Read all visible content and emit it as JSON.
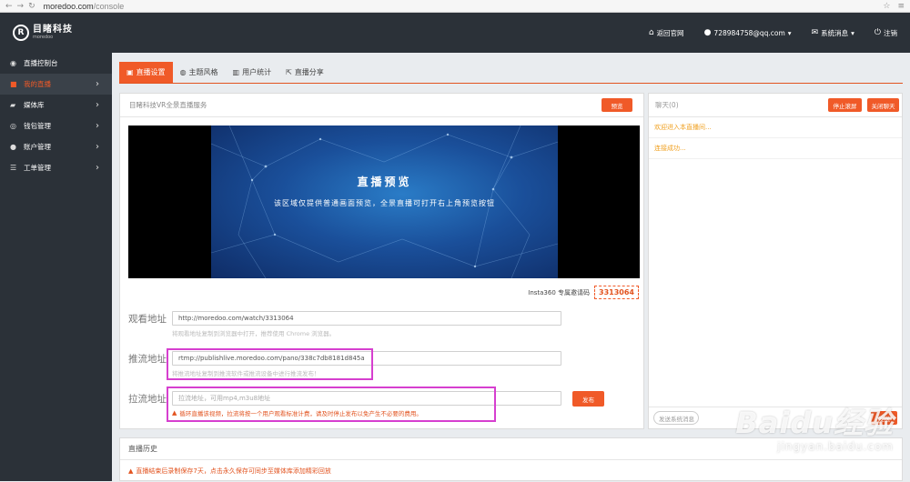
{
  "browser": {
    "url_host": "moredoo.com",
    "url_path": "/console"
  },
  "header": {
    "logo_cn": "目睹科技",
    "logo_en": "moredoo",
    "back_home": "返回官网",
    "user_email": "728984758@qq.com",
    "sys_msg": "系统消息",
    "logout": "注销"
  },
  "sidebar": {
    "items": [
      {
        "label": "直播控制台",
        "icon": "dashboard-icon"
      },
      {
        "label": "我的直播",
        "icon": "video-camera-icon"
      },
      {
        "label": "媒体库",
        "icon": "media-library-icon"
      },
      {
        "label": "钱包管理",
        "icon": "wallet-icon"
      },
      {
        "label": "账户管理",
        "icon": "user-icon"
      },
      {
        "label": "工单管理",
        "icon": "list-icon"
      }
    ]
  },
  "tabs": [
    {
      "label": "直播设置",
      "icon": "settings-icon"
    },
    {
      "label": "主题风格",
      "icon": "palette-icon"
    },
    {
      "label": "用户统计",
      "icon": "chart-icon"
    },
    {
      "label": "直播分享",
      "icon": "share-icon"
    }
  ],
  "main": {
    "panel_title": "目睹科技VR全景直播服务",
    "preview_button": "预览",
    "video_title": "直播预览",
    "video_subtitle": "该区域仅提供普通画面预览，全景直播可打开右上角预览按钮",
    "invite_label": "Insta360 专属邀请码",
    "invite_code": "3313064",
    "watch_label": "观看地址",
    "watch_url": "http://moredoo.com/watch/3313064",
    "watch_hint": "将观看地址复制到浏览器中打开，推荐使用 Chrome 浏览器。",
    "push_label": "推流地址",
    "push_url": "rtmp://publishlive.moredoo.com/pano/338c7db8181d845a",
    "push_hint": "将推流地址复制到推流软件或推流设备中进行推流发布！",
    "pull_label": "拉流地址",
    "pull_placeholder": "拉流地址，可用mp4,m3u8地址",
    "pull_warning": "循环直播该视频，拉流将按一个用户观看标准计费，请及时停止发布以免产生不必要的费用。",
    "publish_button": "发布"
  },
  "chat": {
    "title": "聊天(0)",
    "stop_button": "停止滚屏",
    "close_button": "关闭聊天",
    "messages": [
      "欢迎进入本直播间...",
      "连接成功..."
    ],
    "input_placeholder": "发送系统消息",
    "send_button": "发送"
  },
  "history": {
    "title": "直播历史",
    "note": "直播结束后录制保存7天，点击永久保存可同步至媒体库添加精彩回放"
  },
  "watermark": {
    "big": "Baidu经验",
    "small": "jingyan.baidu.com"
  },
  "colors": {
    "accent": "#f05a28",
    "sidebar_bg": "#2b3138",
    "highlight_box": "#d63fcf"
  }
}
